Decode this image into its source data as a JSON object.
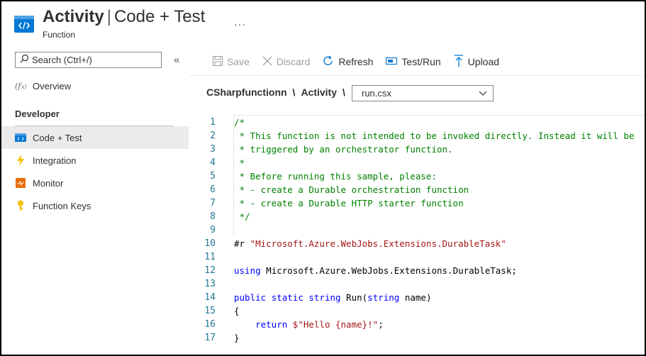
{
  "header": {
    "title_main": "Activity",
    "title_sep": "|",
    "title_sub": "Code + Test",
    "subtitle": "Function",
    "more": "···"
  },
  "sidebar": {
    "search_placeholder": "Search (Ctrl+/)",
    "collapse": "«",
    "overview": "Overview",
    "section": "Developer",
    "items": [
      {
        "label": "Code + Test",
        "icon": "code-icon",
        "active": true
      },
      {
        "label": "Integration",
        "icon": "lightning-icon"
      },
      {
        "label": "Monitor",
        "icon": "monitor-icon"
      },
      {
        "label": "Function Keys",
        "icon": "key-icon"
      }
    ]
  },
  "toolbar": {
    "save": "Save",
    "discard": "Discard",
    "refresh": "Refresh",
    "test_run": "Test/Run",
    "upload": "Upload"
  },
  "breadcrumb": {
    "app": "CSharpfunctionn",
    "sep": "\\",
    "function": "Activity",
    "file": "run.csx"
  },
  "editor": {
    "lines": [
      {
        "n": "1",
        "t": "/*"
      },
      {
        "n": "2",
        "t": " * This function is not intended to be invoked directly. Instead it will be"
      },
      {
        "n": "3",
        "t": " * triggered by an orchestrator function."
      },
      {
        "n": "4",
        "t": " *"
      },
      {
        "n": "5",
        "t": " * Before running this sample, please:"
      },
      {
        "n": "6",
        "t": " * - create a Durable orchestration function"
      },
      {
        "n": "7",
        "t": " * - create a Durable HTTP starter function"
      },
      {
        "n": "8",
        "t": " */"
      },
      {
        "n": "9",
        "t": ""
      },
      {
        "n": "10",
        "t": "#r \"Microsoft.Azure.WebJobs.Extensions.DurableTask\""
      },
      {
        "n": "11",
        "t": ""
      },
      {
        "n": "12",
        "t": "using Microsoft.Azure.WebJobs.Extensions.DurableTask;"
      },
      {
        "n": "13",
        "t": ""
      },
      {
        "n": "14",
        "t": "public static string Run(string name)"
      },
      {
        "n": "15",
        "t": "{"
      },
      {
        "n": "16",
        "t": "    return $\"Hello {name}!\";"
      },
      {
        "n": "17",
        "t": "}"
      }
    ]
  },
  "colors": {
    "accent": "#0078d4",
    "comment": "#008000",
    "keyword": "#0000ff",
    "string": "#a31515",
    "line_number": "#237893"
  }
}
